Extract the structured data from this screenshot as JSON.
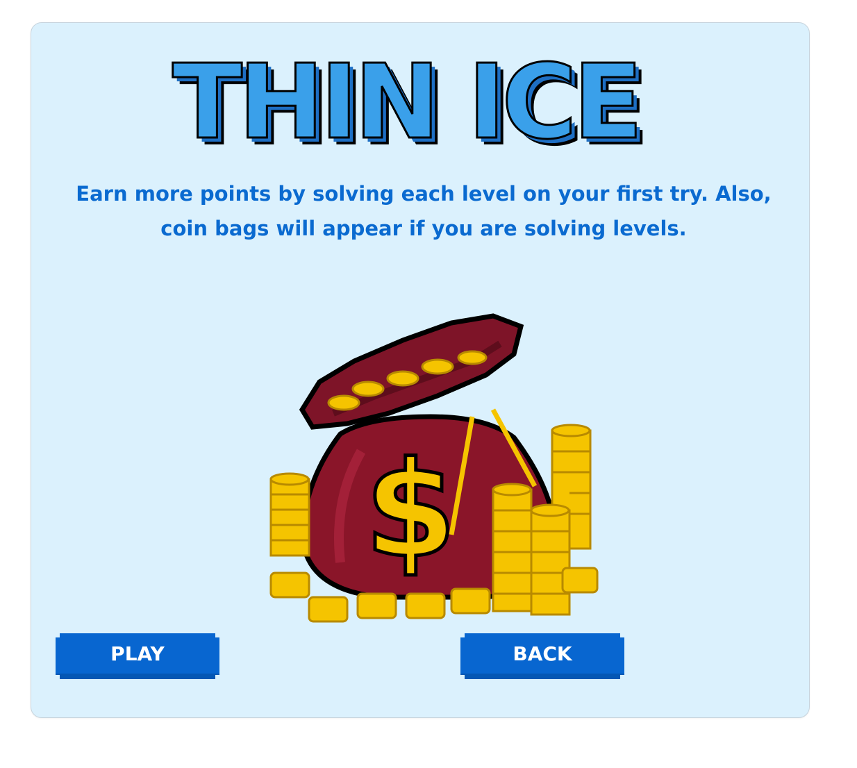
{
  "game": {
    "title": "THIN ICE",
    "description": "Earn more points by solving each level on your first try. Also, coin bags will appear if you are solving levels.",
    "illustration_icon": "coin-bag-icon"
  },
  "buttons": {
    "play_label": "PLAY",
    "back_label": "BACK"
  },
  "colors": {
    "panel_background": "#dbf1fd",
    "text_blue": "#0a6ad0",
    "button_blue": "#0866d0",
    "logo_blue": "#3aa0ea",
    "bag_red": "#7e1428",
    "coin_gold": "#f5c400"
  }
}
